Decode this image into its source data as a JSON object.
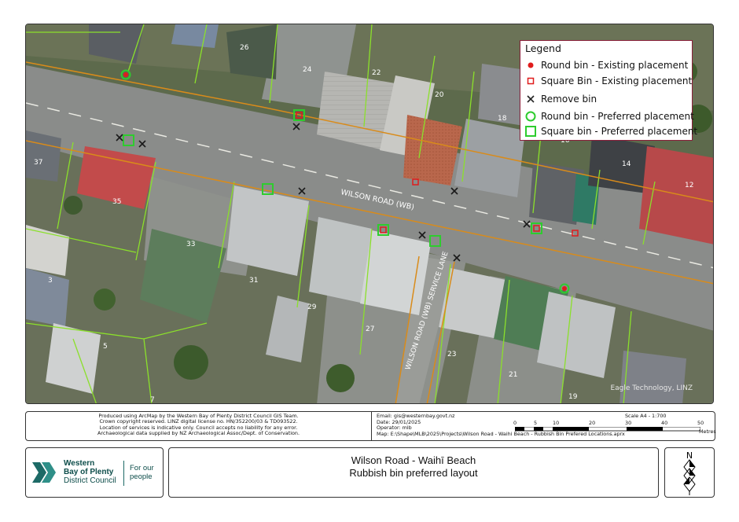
{
  "legend": {
    "title": "Legend",
    "items": [
      {
        "symbol": "round-bin-existing",
        "label": "Round bin - Existing placement"
      },
      {
        "symbol": "square-bin-existing",
        "label": "Square Bin - Existing placement"
      },
      {
        "symbol": "remove-bin",
        "label": "Remove bin"
      },
      {
        "symbol": "round-bin-preferred",
        "label": "Round bin -  Preferred placement"
      },
      {
        "symbol": "square-bin-preferred",
        "label": "Square bin - Preferred placement"
      }
    ]
  },
  "colors": {
    "existing": "#e01c1c",
    "preferred": "#2ecc2e",
    "remove": "#222222",
    "road_border": "#d98b1a",
    "parcel": "#8be02b"
  },
  "map": {
    "road_labels": [
      "WILSON ROAD (WB)",
      "WILSON ROAD (WB) SERVICE LANE"
    ],
    "parcel_numbers": [
      "26",
      "24",
      "22",
      "20",
      "18",
      "16",
      "14",
      "12",
      "37",
      "35",
      "33",
      "31",
      "29",
      "27",
      "23",
      "21",
      "19",
      "3",
      "5",
      "7"
    ],
    "copyright": "Eagle Technology, LINZ"
  },
  "disclaimer": {
    "lines": [
      "Produced using ArcMap by the Western Bay of Plenty District Council  GIS Team.",
      "Crown copyright reserved. LINZ digital license no. HN/352200/03 & TD093522.",
      "Location of services is indicative only. Council accepts no liability for any error.",
      "Archaeological data supplied by NZ Archaeological Assoc/Dept. of Conservation."
    ]
  },
  "meta": {
    "lines": [
      "Email: gis@westernbay.govt.nz",
      "Date: 29/01/2025",
      "Operator: mlb",
      "Map: E:\\Shape\\MLB\\2025\\Projects\\Wilson Road - Waihi Beach - Rubbish Bin Prefered Locations.aprx"
    ]
  },
  "scale": {
    "label": "Scale A4 - 1:700",
    "ticks": [
      "0",
      "5",
      "10",
      "20",
      "30",
      "40",
      "50"
    ],
    "unit": "Metres"
  },
  "logo": {
    "line1": "Western",
    "line2": "Bay of Plenty",
    "line3": "District Council",
    "tag1": "For our",
    "tag2": "people"
  },
  "title": {
    "line1": "Wilson Road - Waihī Beach",
    "line2": "Rubbish bin preferred layout"
  },
  "north": {
    "label": "N"
  }
}
